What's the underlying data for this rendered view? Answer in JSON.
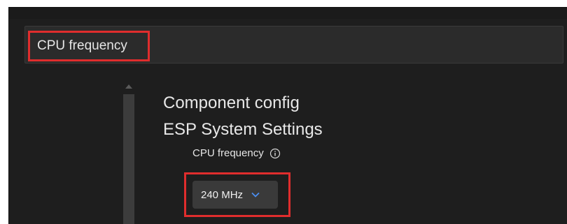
{
  "search": {
    "value": "CPU frequency"
  },
  "breadcrumb": {
    "parent": "Component config",
    "section": "ESP System Settings"
  },
  "setting": {
    "label": "CPU frequency",
    "selected_value": "240 MHz"
  },
  "icons": {
    "info": "info-icon",
    "dropdown": "chevron-down-icon"
  },
  "colors": {
    "highlight": "#e02d2d",
    "chevron": "#4a8ff0",
    "background": "#1e1e1e"
  }
}
